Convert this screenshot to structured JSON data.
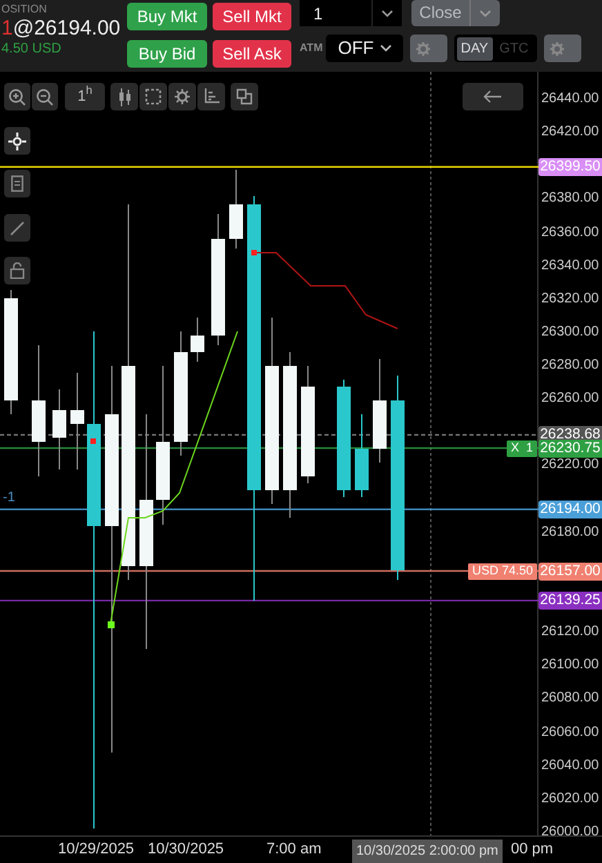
{
  "position": {
    "label": "OSITION",
    "quantity": "1",
    "price": "@26194.00",
    "pnl": "4.50 USD"
  },
  "order_buttons": [
    {
      "label": "Buy Mkt",
      "kind": "buy"
    },
    {
      "label": "Sell Mkt",
      "kind": "sell"
    },
    {
      "label": "Buy Bid",
      "kind": "buy"
    },
    {
      "label": "Sell Ask",
      "kind": "sell"
    }
  ],
  "quantity_field": {
    "value": "1"
  },
  "close_button": {
    "label": "Close",
    "disabled": true
  },
  "atm": {
    "label": "ATM",
    "value": "OFF"
  },
  "tif_toggle": [
    {
      "label": "DAY",
      "selected": true
    },
    {
      "label": "GTC",
      "selected": false
    }
  ],
  "toolbar": {
    "interval": "1$^{h}$"
  },
  "position_marker": "-1",
  "price_axis": [
    "26440.00",
    "26420.00",
    "26380.00",
    "26360.00",
    "26340.00",
    "26320.00",
    "26300.00",
    "26280.00",
    "26260.00",
    "26220.00",
    "26180.00",
    "26120.00",
    "26100.00",
    "26080.00",
    "26060.00",
    "26040.00",
    "26020.00",
    "26000.00"
  ],
  "price_lines": [
    {
      "kind": "alert",
      "price": "26399.50",
      "color": "#d98ef5"
    },
    {
      "kind": "crosshair",
      "price": "26238.68",
      "color": "#555555"
    },
    {
      "kind": "order",
      "price": "26230.75",
      "color": "#2ea043",
      "flag": "X  1"
    },
    {
      "kind": "position",
      "price": "26194.00",
      "color": "#4a9fd8"
    },
    {
      "kind": "last",
      "price": "26157.00",
      "color": "#f08070",
      "flag": "USD 74.50"
    },
    {
      "kind": "level",
      "price": "26139.25",
      "color": "#8a2fc0"
    }
  ],
  "time_axis": {
    "labels": [
      "10/29/2025",
      "10/30/2025",
      "7:00 am"
    ],
    "crosshair_label": "10/30/2025 2:00:00 pm",
    "cut_label": "00 pm"
  }
}
